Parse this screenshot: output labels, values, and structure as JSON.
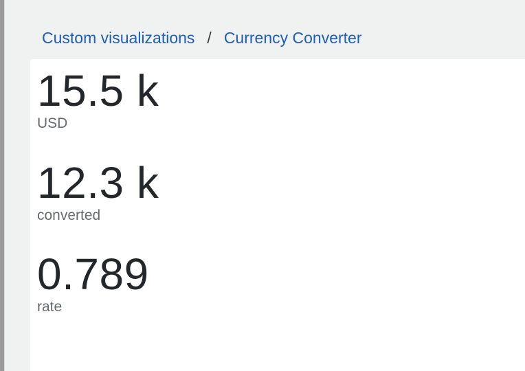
{
  "breadcrumb": {
    "parent": "Custom visualizations",
    "separator": "/",
    "current": "Currency Converter"
  },
  "metrics": [
    {
      "value": "15.5 k",
      "label": "USD"
    },
    {
      "value": "12.3 k",
      "label": "converted"
    },
    {
      "value": "0.789",
      "label": "rate"
    }
  ]
}
